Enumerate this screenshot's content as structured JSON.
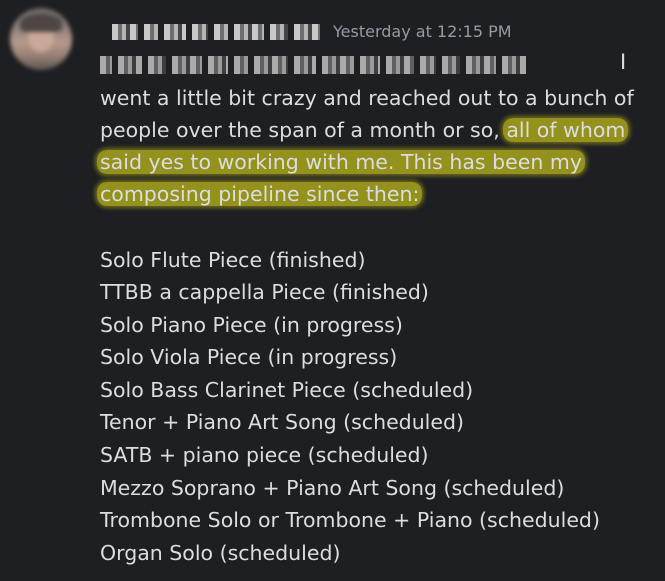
{
  "message": {
    "timestamp": "Yesterday at 12:15 PM",
    "first_line_tail": "I",
    "lines": [
      {
        "plain": "went a little bit crazy and reached out to a bunch of",
        "highlight": ""
      },
      {
        "plain": "people over the span of a month or so, ",
        "highlight": "all of whom"
      },
      {
        "plain": "",
        "highlight": "said yes to working with me. This has been my"
      },
      {
        "plain": "",
        "highlight": "composing pipeline since then:"
      }
    ],
    "pieces": [
      "Solo Flute Piece (finished)",
      "TTBB a cappella Piece (finished)",
      "Solo Piano Piece (in progress)",
      "Solo Viola Piece (in progress)",
      "Solo Bass Clarinet Piece (scheduled)",
      "Tenor + Piano Art Song (scheduled)",
      "SATB + piano piece (scheduled)",
      "Mezzo Soprano + Piano Art Song (scheduled)",
      "Trombone Solo or Trombone + Piano (scheduled)",
      "Organ Solo (scheduled)"
    ]
  },
  "colors": {
    "background": "#1e1f22",
    "text": "#dbdee1",
    "timestamp": "#949ba4",
    "highlight": "#aeab1c"
  }
}
